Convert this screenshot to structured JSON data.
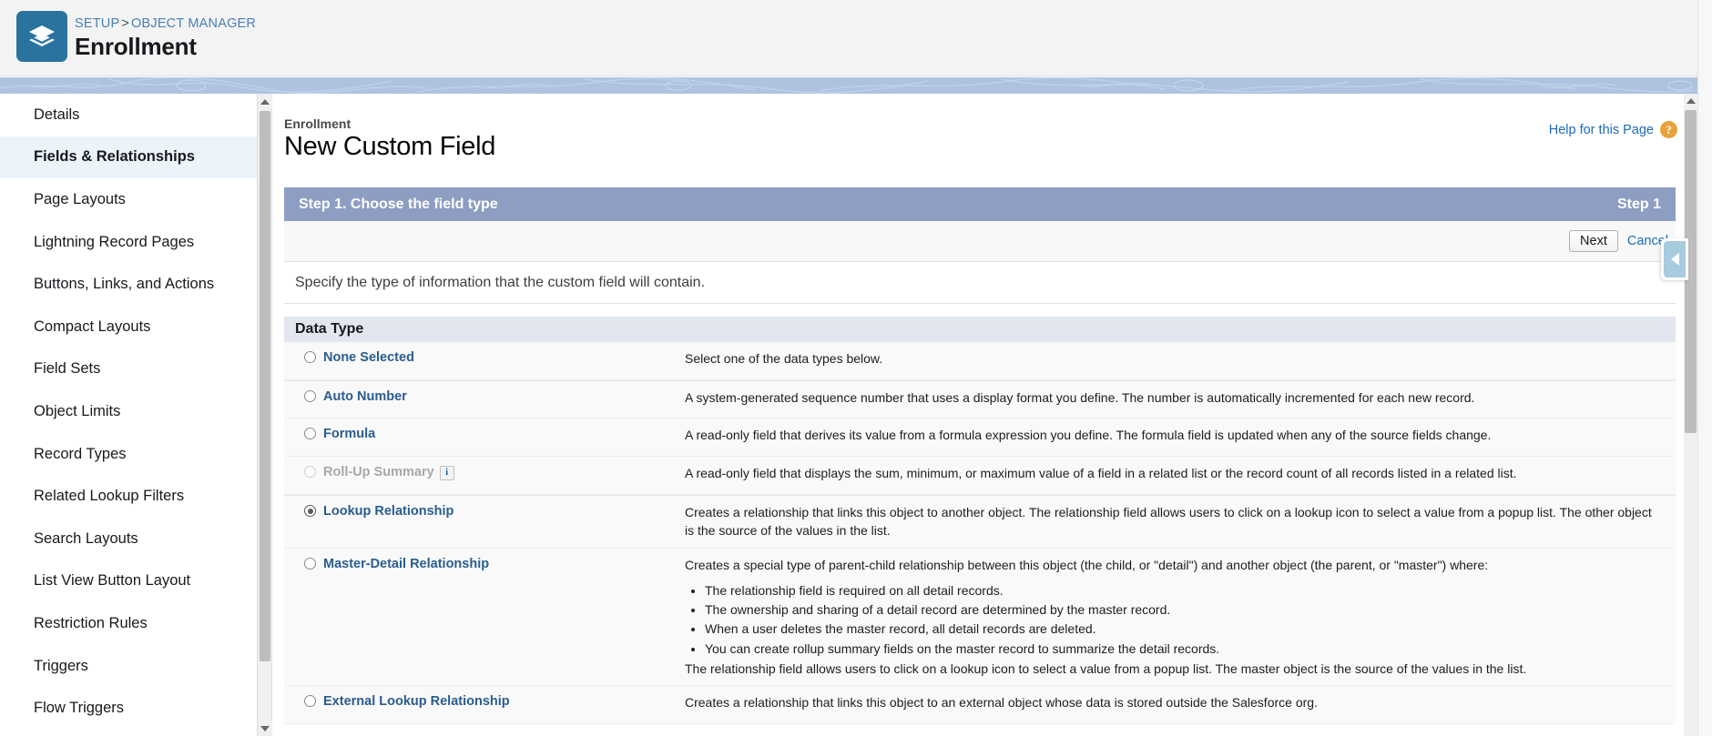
{
  "header": {
    "logo_icon": "stack-layers-icon",
    "breadcrumb": {
      "setup": "SETUP",
      "separator": ">",
      "object_manager": "OBJECT MANAGER"
    },
    "title": "Enrollment",
    "accent_color": "#2a739e"
  },
  "sidebar": {
    "items": [
      {
        "label": "Details",
        "active": false
      },
      {
        "label": "Fields & Relationships",
        "active": true
      },
      {
        "label": "Page Layouts",
        "active": false
      },
      {
        "label": "Lightning Record Pages",
        "active": false
      },
      {
        "label": "Buttons, Links, and Actions",
        "active": false
      },
      {
        "label": "Compact Layouts",
        "active": false
      },
      {
        "label": "Field Sets",
        "active": false
      },
      {
        "label": "Object Limits",
        "active": false
      },
      {
        "label": "Record Types",
        "active": false
      },
      {
        "label": "Related Lookup Filters",
        "active": false
      },
      {
        "label": "Search Layouts",
        "active": false
      },
      {
        "label": "List View Button Layout",
        "active": false
      },
      {
        "label": "Restriction Rules",
        "active": false
      },
      {
        "label": "Triggers",
        "active": false
      },
      {
        "label": "Flow Triggers",
        "active": false
      }
    ],
    "active_background": "#ecf3fb"
  },
  "content": {
    "context_object": "Enrollment",
    "title": "New Custom Field",
    "help_label": "Help for this Page",
    "help_icon": "question-mark-circle-icon",
    "step_bar": {
      "left_label": "Step 1. Choose the field type",
      "right_label": "Step 1",
      "background": "#8d9ec2"
    },
    "actions": {
      "next": "Next",
      "cancel": "Cancel"
    },
    "instruction": "Specify the type of information that the custom field will contain.",
    "section_header": "Data Type"
  },
  "data_types": [
    {
      "label": "None Selected",
      "selected": false,
      "disabled": false,
      "info_icon": false,
      "description": "Select one of the data types below.",
      "bullets": [],
      "description_after": ""
    },
    {
      "label": "Auto Number",
      "selected": false,
      "disabled": false,
      "info_icon": false,
      "description": "A system-generated sequence number that uses a display format you define. The number is automatically incremented for each new record.",
      "bullets": [],
      "description_after": ""
    },
    {
      "label": "Formula",
      "selected": false,
      "disabled": false,
      "info_icon": false,
      "description": "A read-only field that derives its value from a formula expression you define. The formula field is updated when any of the source fields change.",
      "bullets": [],
      "description_after": ""
    },
    {
      "label": "Roll-Up Summary",
      "selected": false,
      "disabled": true,
      "info_icon": true,
      "info_icon_name": "info-icon",
      "description": "A read-only field that displays the sum, minimum, or maximum value of a field in a related list or the record count of all records listed in a related list.",
      "bullets": [],
      "description_after": ""
    },
    {
      "label": "Lookup Relationship",
      "selected": true,
      "disabled": false,
      "info_icon": false,
      "description": "Creates a relationship that links this object to another object. The relationship field allows users to click on a lookup icon to select a value from a popup list. The other object is the source of the values in the list.",
      "bullets": [],
      "description_after": ""
    },
    {
      "label": "Master-Detail Relationship",
      "selected": false,
      "disabled": false,
      "info_icon": false,
      "description": "Creates a special type of parent-child relationship between this object (the child, or \"detail\") and another object (the parent, or \"master\") where:",
      "bullets": [
        "The relationship field is required on all detail records.",
        "The ownership and sharing of a detail record are determined by the master record.",
        "When a user deletes the master record, all detail records are deleted.",
        "You can create rollup summary fields on the master record to summarize the detail records."
      ],
      "description_after": "The relationship field allows users to click on a lookup icon to select a value from a popup list. The master object is the source of the values in the list."
    },
    {
      "label": "External Lookup Relationship",
      "selected": false,
      "disabled": false,
      "info_icon": false,
      "description": "Creates a relationship that links this object to an external object whose data is stored outside the Salesforce org.",
      "bullets": [],
      "description_after": ""
    }
  ],
  "scrollbars": {
    "sidebar_thumb_position": "top",
    "content_thumb_position": "top",
    "collapse_tab_icon": "chevron-left-icon"
  }
}
